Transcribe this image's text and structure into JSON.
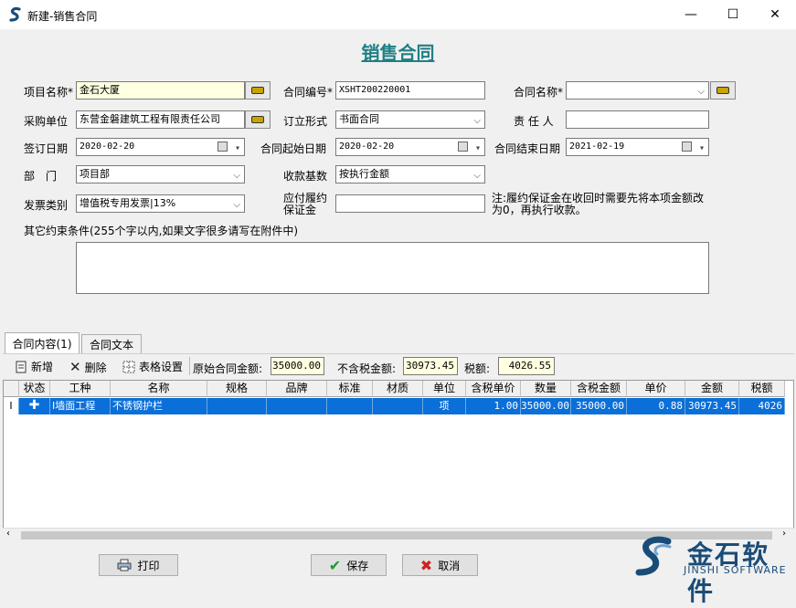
{
  "window": {
    "title": "新建-销售合同",
    "minimize": "—",
    "maximize": "☐",
    "close": "✕"
  },
  "form": {
    "title": "销售合同",
    "project_name_label": "项目名称*",
    "project_name_value": "金石大厦",
    "contract_no_label": "合同编号*",
    "contract_no_value": "XSHT200220001",
    "contract_name_label": "合同名称*",
    "contract_name_value": "",
    "buyer_label": "采购单位",
    "buyer_value": "东营金磐建筑工程有限责任公司",
    "form_type_label": "订立形式",
    "form_type_value": "书面合同",
    "owner_label": "责 任 人",
    "owner_value": "",
    "sign_date_label": "签订日期",
    "sign_date_value": "2020-02-20",
    "start_date_label": "合同起始日期",
    "start_date_value": "2020-02-20",
    "end_date_label": "合同结束日期",
    "end_date_value": "2021-02-19",
    "dept_label": "部　门",
    "dept_value": "项目部",
    "pay_basis_label": "收款基数",
    "pay_basis_value": "按执行金额",
    "invoice_label": "发票类别",
    "invoice_value": "增值税专用发票|13%",
    "deposit_label_1": "应付履约",
    "deposit_label_2": "保证金",
    "deposit_value": "",
    "deposit_note_1": "注:履约保证金在收回时需要先将本项金额改",
    "deposit_note_2": "为0，再执行收款。",
    "other_terms_label": "其它约束条件(255个字以内,如果文字很多请写在附件中)",
    "other_terms_value": ""
  },
  "tabs": [
    {
      "label": "合同内容(1)"
    },
    {
      "label": "合同文本"
    }
  ],
  "toolbar": {
    "add_label": "新增",
    "delete_label": "删除",
    "grid_settings_label": "表格设置",
    "orig_amount_label": "原始合同金额:",
    "orig_amount_value": "35000.00",
    "no_tax_label": "不含税金额:",
    "no_tax_value": "30973.45",
    "tax_label": "税额:",
    "tax_value": "4026.55"
  },
  "grid": {
    "columns": [
      "状态",
      "工种",
      "名称",
      "规格",
      "品牌",
      "标准",
      "材质",
      "单位",
      "含税单价",
      "数量",
      "含税金额",
      "单价",
      "金额",
      "税额"
    ],
    "rows": [
      {
        "indicator": "I",
        "status_icon": "plus-icon",
        "cells": [
          "",
          "I墙面工程",
          "不锈钢护栏",
          "",
          "",
          "",
          "",
          "项",
          "1.00",
          "35000.00",
          "35000.00",
          "0.88",
          "30973.45",
          "4026"
        ]
      }
    ]
  },
  "buttons": {
    "print_label": "打印",
    "save_label": "保存",
    "cancel_label": "取消"
  },
  "logo": {
    "name": "金石软件",
    "subtitle": "JINSHI SOFTWARE"
  },
  "colors": {
    "title_accent": "#1f7f86",
    "selection": "#0a6fd8",
    "required_bg": "#ffffe1"
  }
}
